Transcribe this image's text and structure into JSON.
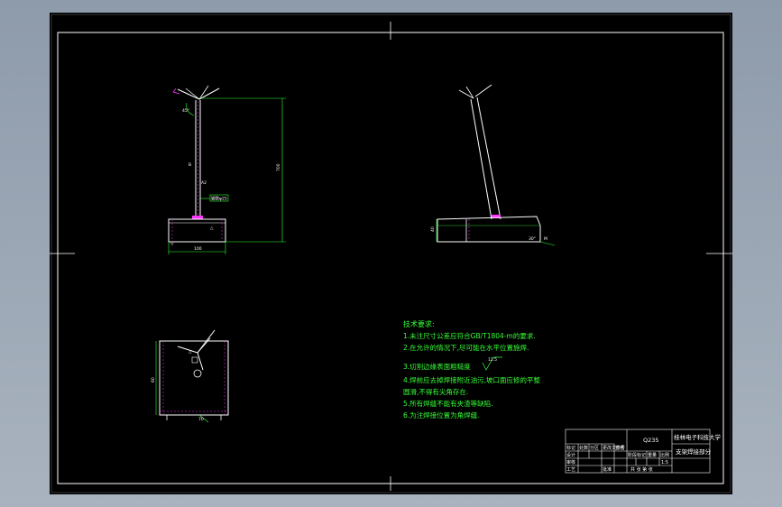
{
  "tech_requirements": {
    "heading": "技术要求:",
    "items": [
      "1.未注尺寸公差应符合GB/T1804-m的要求.",
      "2.在允许的情况下,尽可能在水平位置施焊.",
      "3.切割边缘表面粗糙度",
      "4.焊前应去掉焊接附近油污,坡口面应修的平整",
      "圆滑,不得有尖角存在.",
      "5.所有焊缝不能有夹渣等缺陷.",
      "6.为注焊接位置为角焊缝."
    ],
    "roughness_value": "12.5"
  },
  "title_block": {
    "school": "桂林电子科技大学",
    "drawing_name": "支架焊接部分",
    "material": "Q235",
    "scale_label": "比例",
    "sheet_label": "共 张 第 张",
    "row_labels": [
      "标记",
      "处数",
      "分区",
      "更改文件号",
      "签名",
      "年月日"
    ],
    "role_labels": [
      "设计",
      "审核",
      "工艺",
      "批准"
    ],
    "stage_labels": [
      "阶段标记",
      "重量",
      "比例"
    ],
    "scale_value": "1:5"
  },
  "dimensions": {
    "height": "700",
    "base_width": "100",
    "tube_label": "钢管φ25",
    "angle": "45°",
    "base_height": "40",
    "side_width": "60"
  },
  "colors": {
    "sheet": "#000000",
    "frame": "#ffffff",
    "dimension": "#33ff33",
    "part": "#ffffff",
    "highlight": "#ff33ff",
    "text": "#38ff38"
  }
}
